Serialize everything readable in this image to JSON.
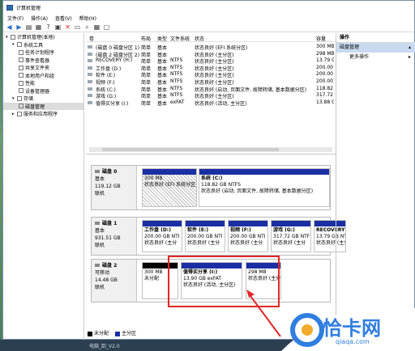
{
  "window": {
    "title": "计算机管理"
  },
  "menu": [
    "文件(F)",
    "操作(A)",
    "查看(V)",
    "帮助(H)"
  ],
  "toolbar_icons": [
    "back-icon",
    "forward-icon",
    "up-icon",
    "properties-icon",
    "help-icon",
    "stop-icon",
    "delete-icon",
    "open-icon",
    "search-icon",
    "properties2-icon",
    "help2-icon"
  ],
  "tree": [
    {
      "label": "计算机管理(本地)",
      "level": 0,
      "icon": "computer-icon"
    },
    {
      "label": "系统工具",
      "level": 1,
      "icon": "tools-icon"
    },
    {
      "label": "任务计划程序",
      "level": 2,
      "icon": "clock-icon"
    },
    {
      "label": "事件查看器",
      "level": 2,
      "icon": "event-icon"
    },
    {
      "label": "共享文件夹",
      "level": 2,
      "icon": "folder-icon"
    },
    {
      "label": "本地用户和组",
      "level": 2,
      "icon": "users-icon"
    },
    {
      "label": "性能",
      "level": 2,
      "icon": "performance-icon"
    },
    {
      "label": "设备管理器",
      "level": 2,
      "icon": "device-icon"
    },
    {
      "label": "存储",
      "level": 1,
      "icon": "storage-icon"
    },
    {
      "label": "磁盘管理",
      "level": 2,
      "icon": "disk-icon"
    },
    {
      "label": "服务和应用程序",
      "level": 1,
      "icon": "services-icon"
    }
  ],
  "volumes": {
    "columns": [
      "卷",
      "布局",
      "类型",
      "文件系统",
      "状态",
      "容量"
    ],
    "rows": [
      [
        "(磁盘 0 磁盘分区 1)",
        "简单",
        "基本",
        "",
        "状态良好 (EFI 系统分区)",
        "300 MB"
      ],
      [
        "(磁盘 2 磁盘分区 2)",
        "简单",
        "基本",
        "",
        "状态良好 (主分区)",
        "298 MB"
      ],
      [
        "RECOVERY (H:)",
        "简单",
        "基本",
        "NTFS",
        "状态良好 (主分区)",
        "13.79 G"
      ],
      [
        "工作盘 (D:)",
        "简单",
        "基本",
        "NTFS",
        "状态良好 (主分区)",
        "200.00"
      ],
      [
        "软件 (E:)",
        "简单",
        "基本",
        "NTFS",
        "状态良好 (主分区)",
        "200.00"
      ],
      [
        "视频 (F:)",
        "简单",
        "基本",
        "NTFS",
        "状态良好 (主分区)",
        "200.00"
      ],
      [
        "系统 (C:)",
        "简单",
        "基本",
        "NTFS",
        "状态良好 (启动, 页面文件, 故障转储, 基本数据分区)",
        "118.82"
      ],
      [
        "游戏 (G:)",
        "简单",
        "基本",
        "NTFS",
        "状态良好 (主分区)",
        "317.72"
      ],
      [
        "值得买分享 (I:)",
        "简单",
        "基本",
        "exFAT",
        "状态良好 (活动, 主分区)",
        "13.88 G"
      ]
    ]
  },
  "disks": [
    {
      "name": "磁盘 0",
      "type": "基本",
      "size": "119.12 GB",
      "status": "联机",
      "partitions": [
        {
          "title": "",
          "size": "300 MB",
          "status": "状态良好 (EFI 系统分区)",
          "bar": "blue",
          "hatch": true
        },
        {
          "title": "系统  (C:)",
          "size": "118.82 GB NTFS",
          "status": "状态良好 (启动, 页面文件, 故障转储, 基本数据分区)",
          "bar": "blue",
          "hatch": false
        }
      ]
    },
    {
      "name": "磁盘 1",
      "type": "基本",
      "size": "931.51 GB",
      "status": "联机",
      "partitions": [
        {
          "title": "工作盘  (D:)",
          "size": "200.00 GB NTI",
          "status": "状态良好 (主分",
          "bar": "blue",
          "hatch": false
        },
        {
          "title": "软件  (E:)",
          "size": "200.00 GB NTI",
          "status": "状态良好 (主分",
          "bar": "blue",
          "hatch": false
        },
        {
          "title": "视频  (F:)",
          "size": "200.00 GB NTI",
          "status": "状态良好 (主分",
          "bar": "blue",
          "hatch": false
        },
        {
          "title": "游戏  (G:)",
          "size": "317.72 GB NTF",
          "status": "状态良好 (主分",
          "bar": "blue",
          "hatch": false
        },
        {
          "title": "RECOVERY",
          "size": "13.79 GB NTF",
          "status": "状态良好 (主分",
          "bar": "blue",
          "hatch": false
        }
      ]
    },
    {
      "name": "磁盘 2",
      "type": "可移动",
      "size": "14.48 GB",
      "status": "联机",
      "partitions": [
        {
          "title": "",
          "size": "300 MB",
          "status": "未分配",
          "bar": "black",
          "hatch": false
        },
        {
          "title": "值得买分享  (I:)",
          "size": "13.90 GB exFAT",
          "status": "状态良好 (活动, 主分区)",
          "bar": "blue",
          "hatch": false
        },
        {
          "title": "",
          "size": "298 MB",
          "status": "状态良好 (主分",
          "bar": "blue",
          "hatch": false
        }
      ]
    }
  ],
  "legend": [
    {
      "label": "未分配",
      "color": "#000000"
    },
    {
      "label": "主分区",
      "color": "#1a2fa4"
    }
  ],
  "actions": {
    "header": "操作",
    "section": "磁盘管理",
    "more": "更多操作"
  },
  "watermark": {
    "brand": "恰卡网",
    "url": "qiaqa.com"
  },
  "taskbar": {
    "text": "电脑_卸_V2.0"
  }
}
